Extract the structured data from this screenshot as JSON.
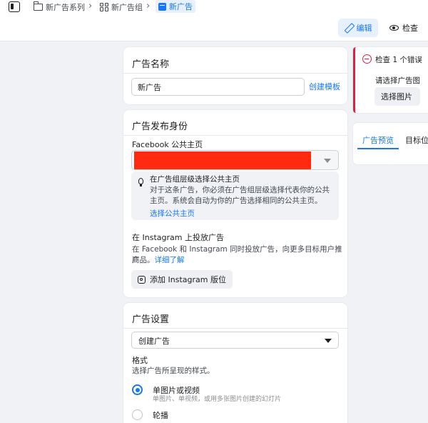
{
  "breadcrumb": {
    "campaign": "新广告系列",
    "adset": "新广告组",
    "ad": "新广告"
  },
  "header": {
    "edit_label": "编辑",
    "review_label": "检查"
  },
  "ad_name": {
    "title": "广告名称",
    "value": "新广告",
    "create_template_link": "创建模板"
  },
  "identity": {
    "title": "广告发布身份",
    "facebook_page_label": "Facebook 公共主页",
    "tip_title": "在广告组层级选择公共主页",
    "tip_body_1": "对于这条广告，你必须在广告组层级选择代表你的公共",
    "tip_body_2": "主页。系统会自动为你的广告选择相同的公共主页。",
    "tip_link": "选择公共主页",
    "instagram_label": "在 Instagram 上投放广告",
    "instagram_desc_1": "在 Facebook 和 Instagram 同时投放广告，向更多目标用户推广",
    "instagram_desc_2": "商品。",
    "instagram_learn_more": "详细了解",
    "add_instagram_button": "添加 Instagram 版位"
  },
  "ad_setup": {
    "title": "广告设置",
    "create_select_value": "创建广告",
    "format_label": "格式",
    "format_desc": "选择广告所呈现的样式。",
    "options": [
      {
        "label": "单图片或视频",
        "desc": "单图片、单视频，或用多张图片创建的幻灯片",
        "selected": true
      },
      {
        "label": "轮播",
        "desc": "",
        "selected": false
      }
    ]
  },
  "errors": {
    "title": "检查 1 个错误",
    "message": "请选择广告图片。",
    "select_image_button": "选择图片"
  },
  "preview": {
    "tabs": [
      "广告预览",
      "目标位"
    ]
  },
  "colors": {
    "accent": "#1877f2",
    "error": "#e41e3f"
  }
}
